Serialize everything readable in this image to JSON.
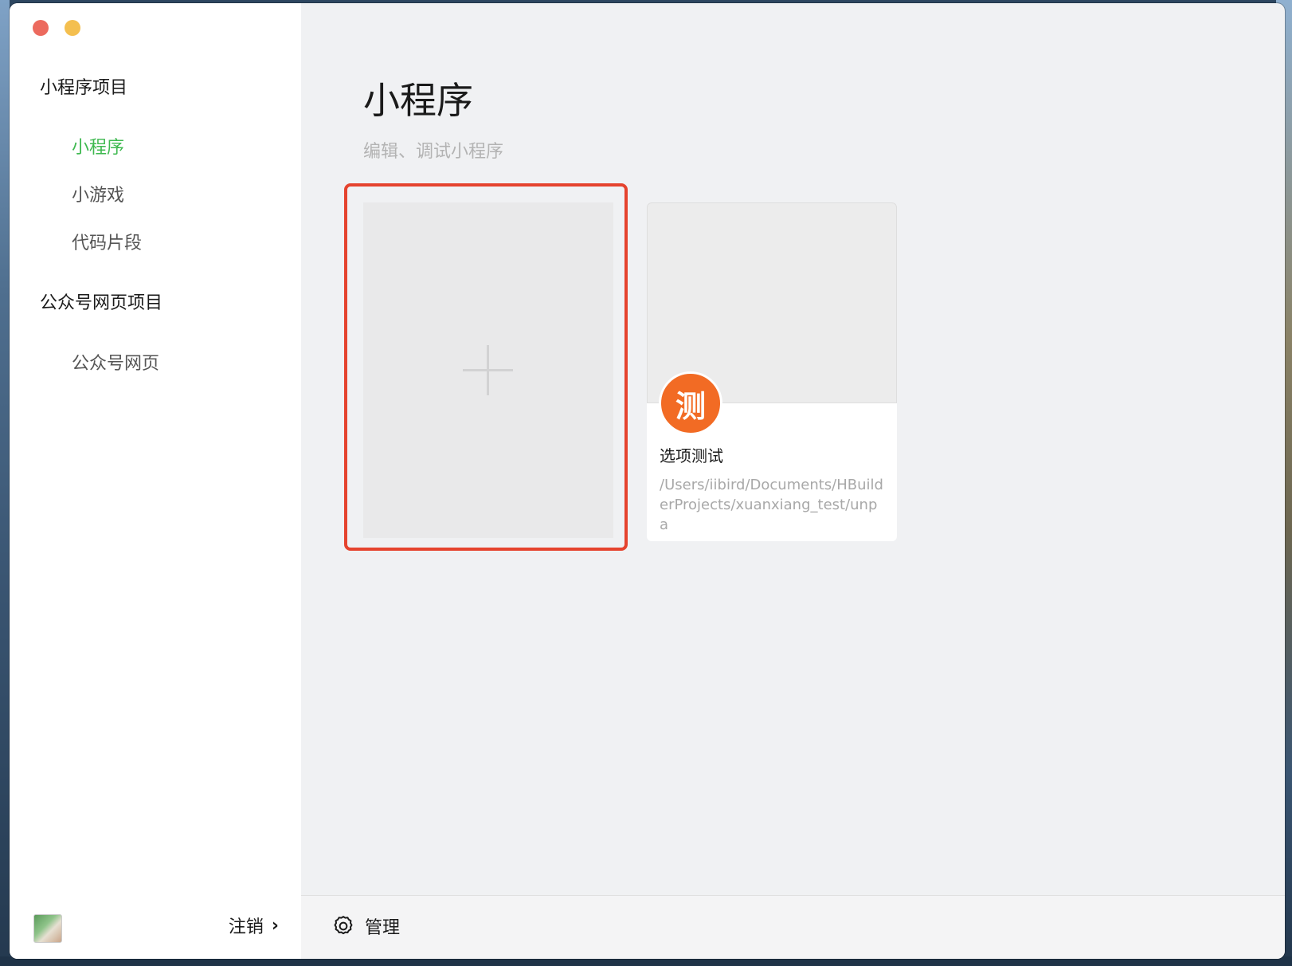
{
  "sidebar": {
    "groups": [
      {
        "label": "小程序项目",
        "items": [
          {
            "label": "小程序"
          },
          {
            "label": "小游戏"
          },
          {
            "label": "代码片段"
          }
        ]
      },
      {
        "label": "公众号网页项目",
        "items": [
          {
            "label": "公众号网页"
          }
        ]
      }
    ],
    "footer": {
      "logout_label": "注销",
      "chevron": "›"
    }
  },
  "main": {
    "title": "小程序",
    "subtitle": "编辑、调试小程序",
    "new_project_icon": "plus-icon",
    "projects": [
      {
        "icon_text": "测",
        "name": "选项测试",
        "path": "/Users/iibird/Documents/HBuilderProjects/xuanxiang_test/unpa"
      }
    ]
  },
  "bottom_bar": {
    "manage_label": "管理",
    "manage_icon": "gear-icon"
  },
  "colors": {
    "accent": "#3fb950",
    "highlight_border": "#e5432e",
    "project_icon_bg": "#f26b24"
  }
}
